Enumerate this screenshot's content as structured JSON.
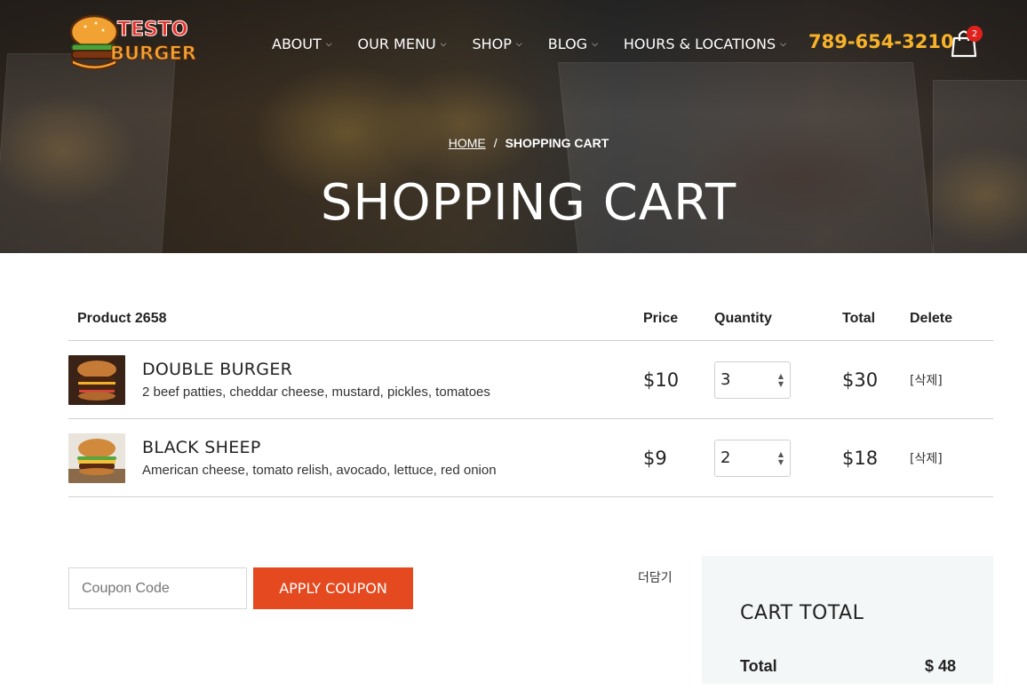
{
  "header": {
    "logo": {
      "line1": "TESTO",
      "line2": "BURGER"
    },
    "nav": [
      {
        "label": "ABOUT"
      },
      {
        "label": "OUR MENU"
      },
      {
        "label": "SHOP"
      },
      {
        "label": "BLOG"
      },
      {
        "label": "HOURS & LOCATIONS"
      }
    ],
    "phone": "789-654-3210",
    "cart_count": "2"
  },
  "hero": {
    "breadcrumb": {
      "home": "HOME",
      "separator": "/",
      "current": "SHOPPING CART"
    },
    "title": "SHOPPING CART"
  },
  "table": {
    "headers": {
      "product": "Product 2658",
      "price": "Price",
      "quantity": "Quantity",
      "total": "Total",
      "delete": "Delete"
    },
    "rows": [
      {
        "name": "DOUBLE BURGER",
        "desc": "2 beef patties, cheddar cheese, mustard, pickles, tomatoes",
        "price": "$10",
        "qty": "3",
        "total": "$30",
        "delete": "[삭제]"
      },
      {
        "name": "BLACK SHEEP",
        "desc": "American cheese, tomato relish, avocado, lettuce, red onion",
        "price": "$9",
        "qty": "2",
        "total": "$18",
        "delete": "[삭제]"
      }
    ]
  },
  "coupon": {
    "placeholder": "Coupon Code",
    "apply_label": "APPLY COUPON"
  },
  "more_label": "더담기",
  "cart_total": {
    "title": "CART TOTAL",
    "label": "Total",
    "value": "$ 48"
  },
  "colors": {
    "accent": "#e5491f",
    "phone": "#f7b22a",
    "badge": "#e0201b",
    "total_bg": "#f4f7f8"
  }
}
